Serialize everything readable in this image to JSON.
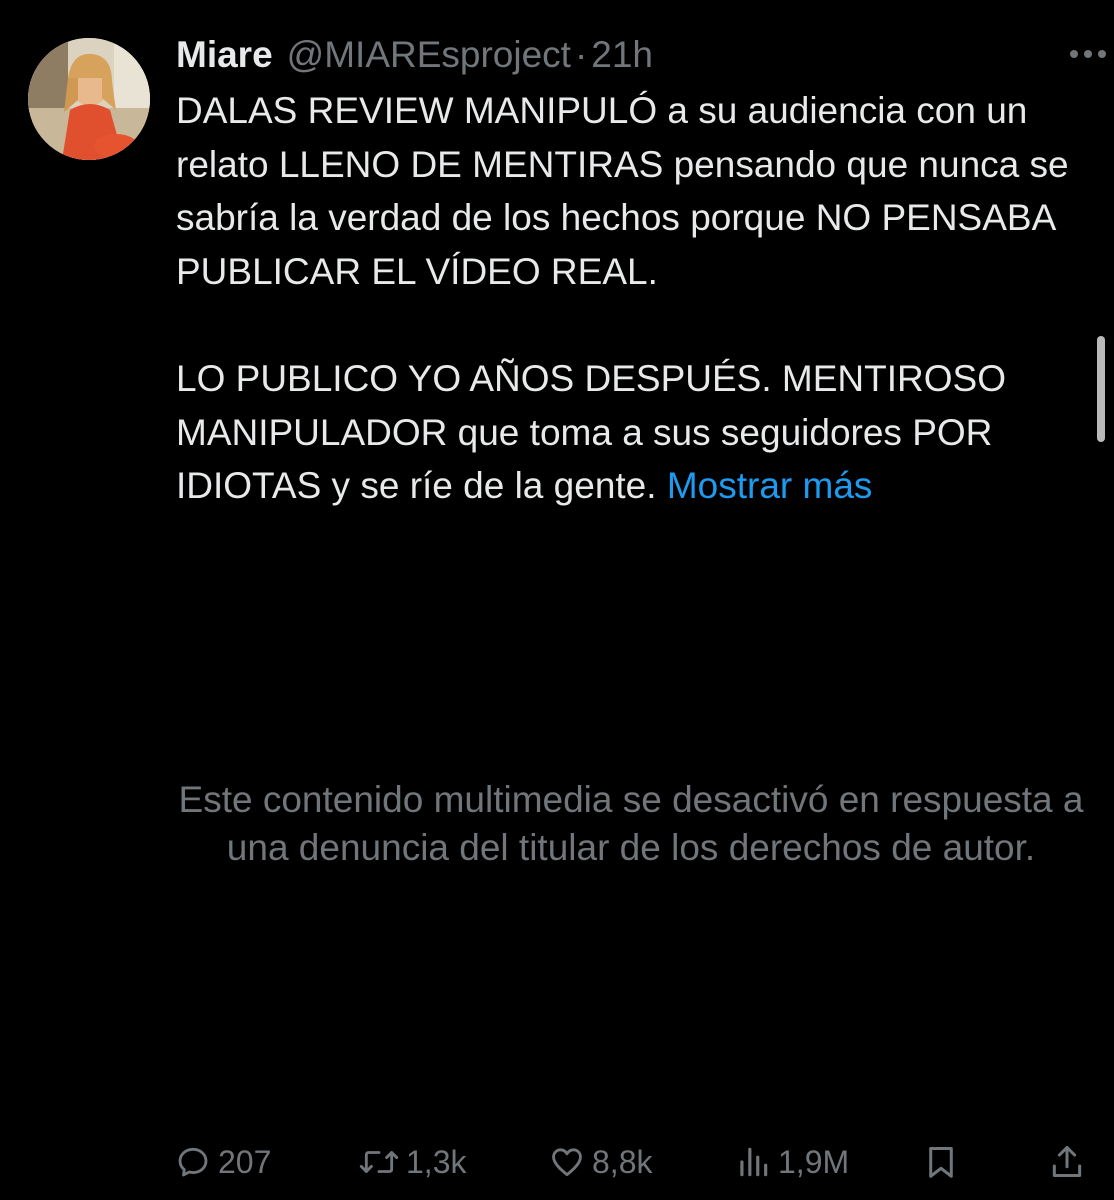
{
  "tweet": {
    "display_name": "Miare",
    "handle": "@MIAREsproject",
    "separator": "·",
    "time": "21h",
    "avatar_icon": "avatar-photo",
    "more_icon": "ellipsis-icon",
    "paragraphs": [
      "DALAS REVIEW MANIPULÓ a su audiencia con un relato LLENO DE MENTIRAS pensando que nunca se sabría la verdad de los hechos porque NO PENSABA PUBLICAR EL VÍDEO REAL.",
      "LO PUBLICO YO AÑOS DESPUÉS. MENTIROSO MANIPULADOR que toma a sus seguidores POR IDIOTAS y se ríe de la gente."
    ],
    "show_more": "Mostrar más",
    "media_notice": "Este contenido multimedia se desactivó en respuesta a una denuncia del titular de los derechos de autor."
  },
  "actions": {
    "replies": {
      "count": "207",
      "icon": "reply-icon"
    },
    "reposts": {
      "count": "1,3k",
      "icon": "repost-icon"
    },
    "likes": {
      "count": "8,8k",
      "icon": "like-icon"
    },
    "views": {
      "count": "1,9M",
      "icon": "views-icon"
    },
    "bookmark": {
      "icon": "bookmark-icon"
    },
    "share": {
      "icon": "share-icon"
    }
  },
  "colors": {
    "background": "#000000",
    "text": "#e7e9ea",
    "secondary": "#71767b",
    "link": "#1d9bf0"
  }
}
